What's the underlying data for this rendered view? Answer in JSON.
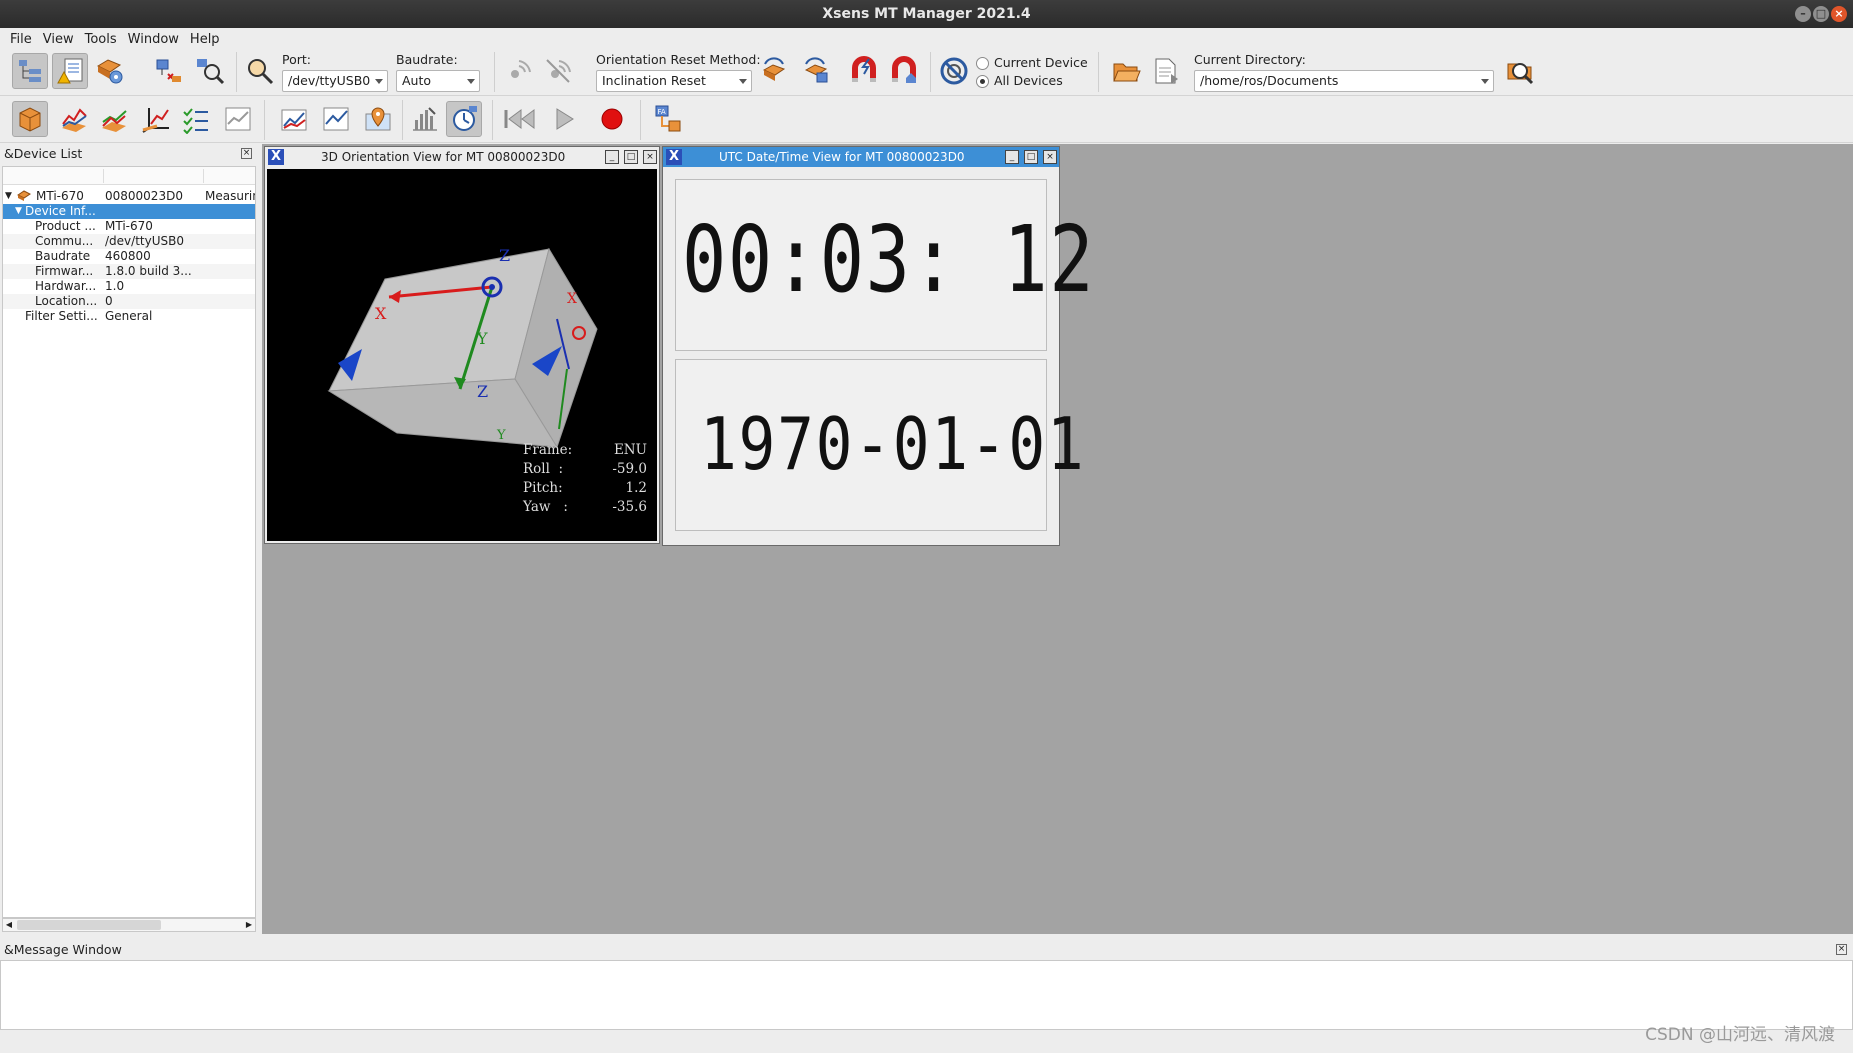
{
  "window": {
    "title": "Xsens MT Manager 2021.4"
  },
  "menu": [
    "File",
    "View",
    "Tools",
    "Window",
    "Help"
  ],
  "toolbar": {
    "port_label": "Port:",
    "port_value": "/dev/ttyUSB0",
    "baud_label": "Baudrate:",
    "baud_value": "Auto",
    "orient_label": "Orientation Reset Method:",
    "orient_value": "Inclination Reset",
    "radio_current": "Current Device",
    "radio_all": "All Devices",
    "dir_label": "Current Directory:",
    "dir_value": "/home/ros/Documents"
  },
  "device_list": {
    "title": "&Device List",
    "rows": [
      {
        "c1": "MTi-670",
        "c2": "00800023D0",
        "c3": "Measurin"
      },
      {
        "c1": "Device Inf...",
        "c2": "",
        "c3": ""
      },
      {
        "c1": "Product ...",
        "c2": "MTi-670",
        "c3": ""
      },
      {
        "c1": "Commu...",
        "c2": "/dev/ttyUSB0",
        "c3": ""
      },
      {
        "c1": "Baudrate",
        "c2": "460800",
        "c3": ""
      },
      {
        "c1": "Firmwar...",
        "c2": "1.8.0 build 3...",
        "c3": ""
      },
      {
        "c1": "Hardwar...",
        "c2": "1.0",
        "c3": ""
      },
      {
        "c1": "Location...",
        "c2": "0",
        "c3": ""
      },
      {
        "c1": "Filter Setti...",
        "c2": "General",
        "c3": ""
      }
    ]
  },
  "orientation_view": {
    "title": "3D Orientation View for MT 00800023D0",
    "frame_label": "Frame:",
    "frame_value": "ENU",
    "roll_label": "Roll  :",
    "roll_value": "-59.0",
    "pitch_label": "Pitch:",
    "pitch_value": "1.2",
    "yaw_label": "Yaw   :",
    "yaw_value": "-35.6"
  },
  "utc_view": {
    "title": "UTC Date/Time View for MT 00800023D0",
    "time": "00:03: 12",
    "date": "1970-01-01"
  },
  "message_window": {
    "title": "&Message Window"
  },
  "watermark": "CSDN @山河远、清风渡"
}
